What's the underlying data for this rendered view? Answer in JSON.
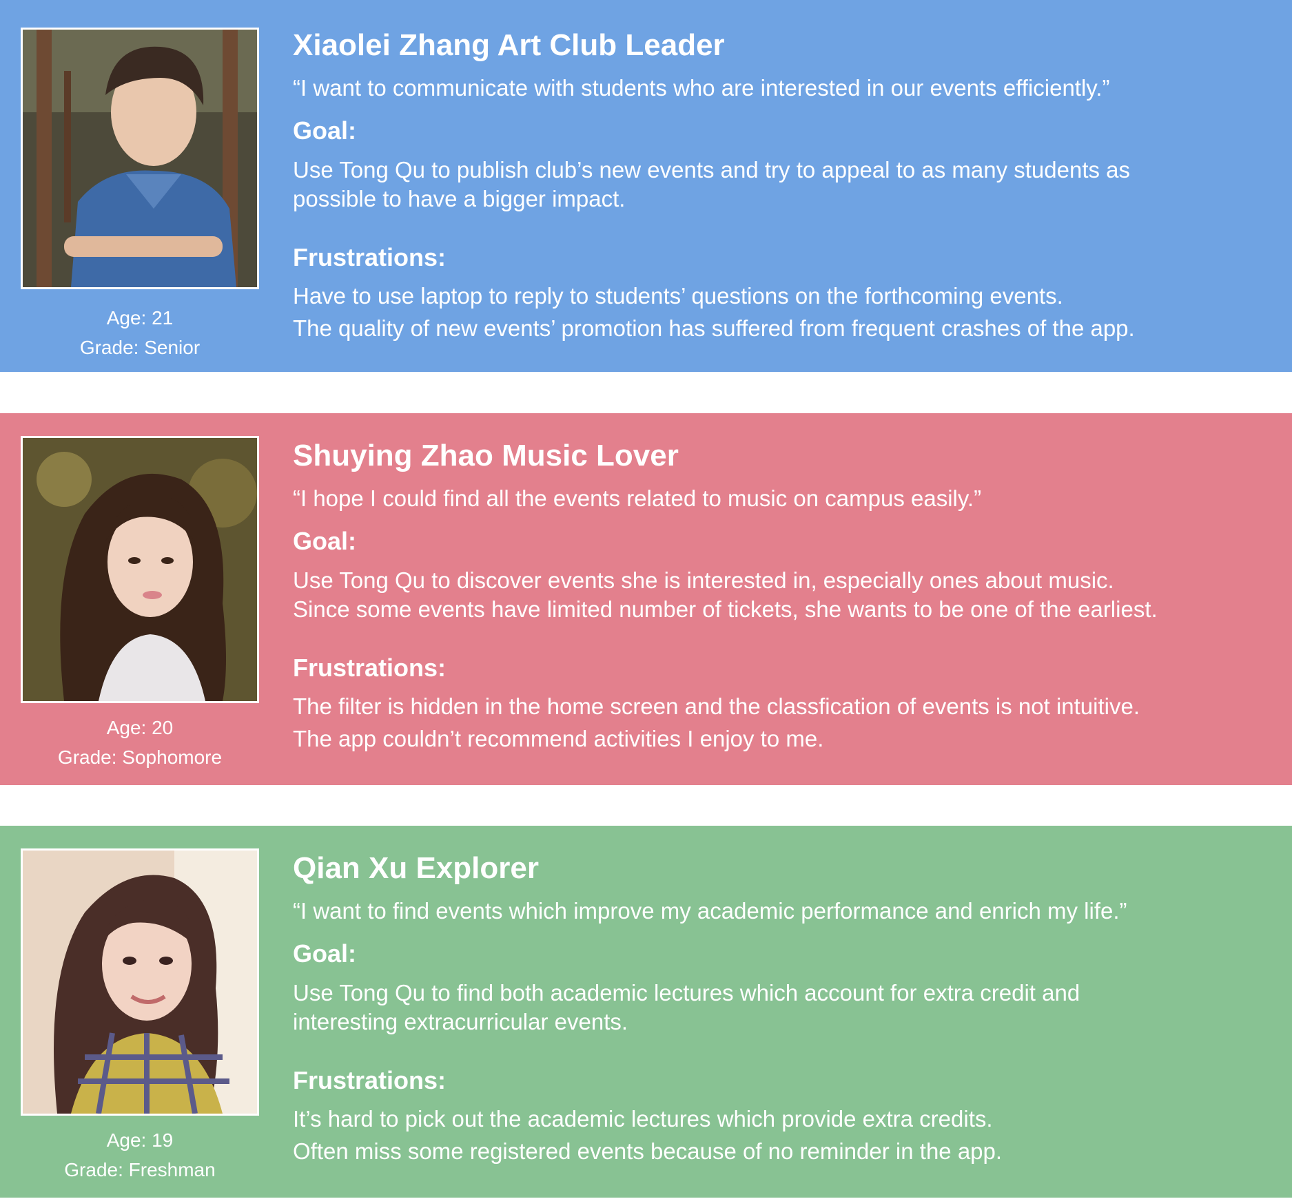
{
  "colors": {
    "persona_0_bg": "#6fa3e3",
    "persona_1_bg": "#e3808d",
    "persona_2_bg": "#88c293",
    "text": "#ffffff",
    "gap": "#ffffff"
  },
  "personas": [
    {
      "name": "Xiaolei Zhang Art Club Leader",
      "age": "Age: 21",
      "grade": "Grade: Senior",
      "photo_icon": "portrait-photo-male",
      "quote": "“I want to communicate with students who are interested in our events efficiently.”",
      "goal_heading": "Goal:",
      "goal_lines": [
        "Use Tong Qu to publish club’s new events and try to appeal to as many students as",
        "possible to have a bigger impact."
      ],
      "frustrations_heading": "Frustrations:",
      "frustrations": [
        "Have to use laptop to reply to students’ questions on the forthcoming events.",
        "The quality of new events’ promotion has suffered from frequent crashes of the app."
      ]
    },
    {
      "name": "Shuying Zhao Music Lover",
      "age": "Age: 20",
      "grade": "Grade: Sophomore",
      "photo_icon": "portrait-photo-female",
      "quote": "“I hope I could find all the events related to music on campus easily.”",
      "goal_heading": "Goal:",
      "goal_lines": [
        "Use Tong Qu to discover events she is interested in, especially ones about music.",
        "Since some events have limited number of tickets, she wants to be one of the earliest."
      ],
      "frustrations_heading": "Frustrations:",
      "frustrations": [
        "The filter is hidden in the home screen and the classfication of events is not intuitive.",
        "The app couldn’t recommend activities I enjoy to me."
      ]
    },
    {
      "name": "Qian Xu Explorer",
      "age": "Age: 19",
      "grade": "Grade: Freshman",
      "photo_icon": "portrait-photo-female",
      "quote": "“I want to find events which improve my academic performance and enrich my life.”",
      "goal_heading": "Goal:",
      "goal_lines": [
        "Use Tong Qu to find both academic lectures which account for extra credit and",
        "interesting extracurricular events."
      ],
      "frustrations_heading": "Frustrations:",
      "frustrations": [
        "It’s hard to pick out the academic lectures which provide extra credits.",
        "Often miss some registered events because of no reminder in the app."
      ]
    }
  ]
}
